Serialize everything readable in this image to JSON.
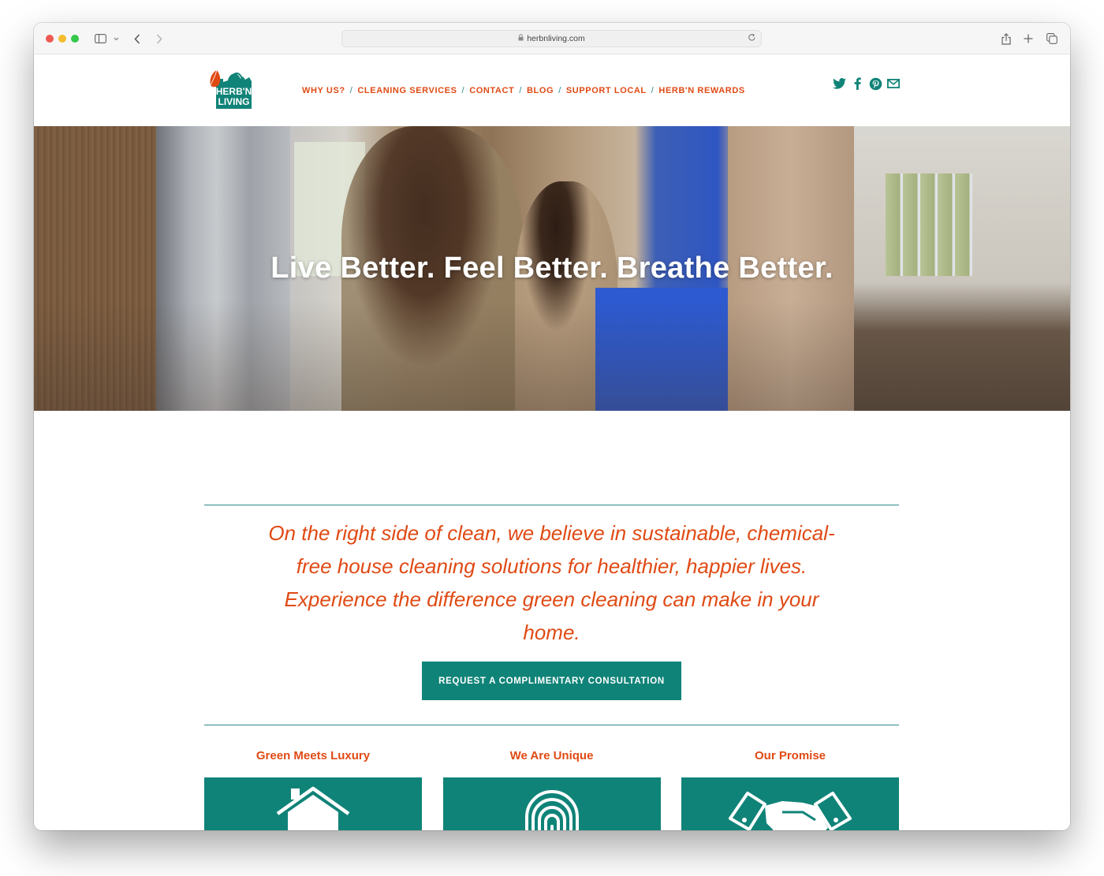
{
  "browser": {
    "url": "herbnliving.com",
    "icons": [
      "sidebar-icon",
      "chevron-down-icon",
      "back-icon",
      "forward-icon",
      "lock-icon",
      "reload-icon",
      "share-icon",
      "new-tab-icon",
      "tabs-overview-icon"
    ]
  },
  "site": {
    "logo": {
      "line1": "HERB'N",
      "line2": "LIVING"
    },
    "nav": [
      {
        "label": "WHY US?"
      },
      {
        "label": "CLEANING SERVICES"
      },
      {
        "label": "CONTACT"
      },
      {
        "label": "BLOG"
      },
      {
        "label": "SUPPORT LOCAL"
      },
      {
        "label": "HERB'N REWARDS"
      }
    ],
    "nav_separator": "/",
    "social": [
      "twitter-icon",
      "facebook-icon",
      "pinterest-icon",
      "email-icon"
    ]
  },
  "hero": {
    "headline": "Live Better. Feel Better. Breathe Better."
  },
  "intro": {
    "text": "On the right side of clean, we believe in sustainable, chemical-free house cleaning solutions for healthier, happier lives. Experience the difference green cleaning can make in your home.",
    "cta_label": "REQUEST A COMPLIMENTARY CONSULTATION"
  },
  "features": [
    {
      "title": "Green Meets Luxury",
      "icon": "house-leaf-icon"
    },
    {
      "title": "We Are Unique",
      "icon": "fingerprint-icon"
    },
    {
      "title": "Our Promise",
      "icon": "handshake-icon"
    }
  ],
  "colors": {
    "brand_orange": "#e04a14",
    "brand_teal": "#108378",
    "rule_teal": "#2a8a86"
  }
}
